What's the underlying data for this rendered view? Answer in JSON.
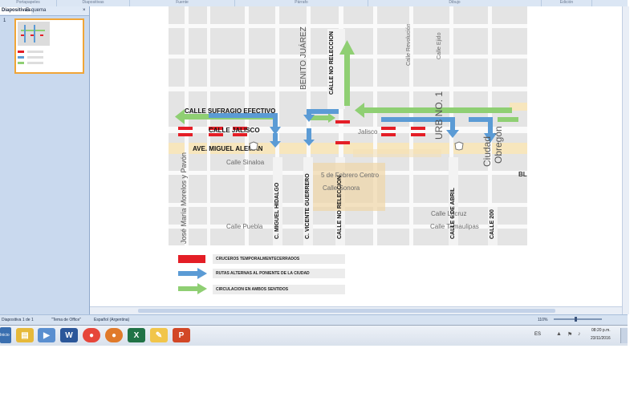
{
  "ribbon": {
    "groups": [
      "Portapapeles",
      "Diapositivas",
      "Fuente",
      "Párrafo",
      "Dibujo",
      "Edición"
    ]
  },
  "left_pane": {
    "tabs": [
      "Diapositivas",
      "Esquema"
    ],
    "close_glyph": "×",
    "slide_number": "1"
  },
  "map": {
    "bold_labels": {
      "sufragio": "CALLE SUFRAGIO EFECTIVO",
      "jalisco": "CALLE JALISCO",
      "aleman": "AVE. MIGUEL ALEMAN"
    },
    "vertical_bold_labels": {
      "benito": "BENITO JUÁREZ",
      "no_reeleccion_top": "CALLE NO RELECCION",
      "miguel_hidalgo": "C. MIGUEL HIDALGO",
      "vicente_guerrero": "C. VICENTE GUERRERO",
      "no_reeleccion_bottom": "CALLE NO RELECCION",
      "seis_abril": "CALLE 6 DE ABRIL",
      "doscientos": "CALLE 200",
      "jose_maria": "José María Morelos y Pavón"
    },
    "gray_labels": {
      "jalisco": "Jalisco",
      "sinaloa": "Calle Sinaloa",
      "febrero": "5 de Febrero Centro",
      "sonora": "Calle Sonora",
      "puebla": "Calle Puebla",
      "lacruz": "Calle Lacruz",
      "tamaulipas": "Calle Tamaulipas",
      "revolucion": "Calle Revolución",
      "ejido": "Calle Ejido",
      "urbano": "URB NO. 1",
      "ciudad": "Ciudad",
      "obregon": "Obregón",
      "bl": "BL"
    },
    "colors": {
      "red": "#e41e26",
      "blue": "#5b9bd5",
      "green": "#8fcf73"
    }
  },
  "legend": {
    "closed": "CRUCEROS TEMPORALMENTECERRADOS",
    "alternate": "RUTAS ALTERNAS AL PONIENTE DE LA CIUDAD",
    "both_ways": "CIRCULACION EN AMBOS SENTIDOS"
  },
  "status_bar": {
    "slide_counter": "Diapositiva 1 de 1",
    "theme": "\"Tema de Office\"",
    "language": "Español (Argentina)",
    "zoom": "110%"
  },
  "taskbar": {
    "start": "Inicio",
    "language": "ES",
    "time": "08:20 p.m.",
    "date": "23/11/2016"
  }
}
